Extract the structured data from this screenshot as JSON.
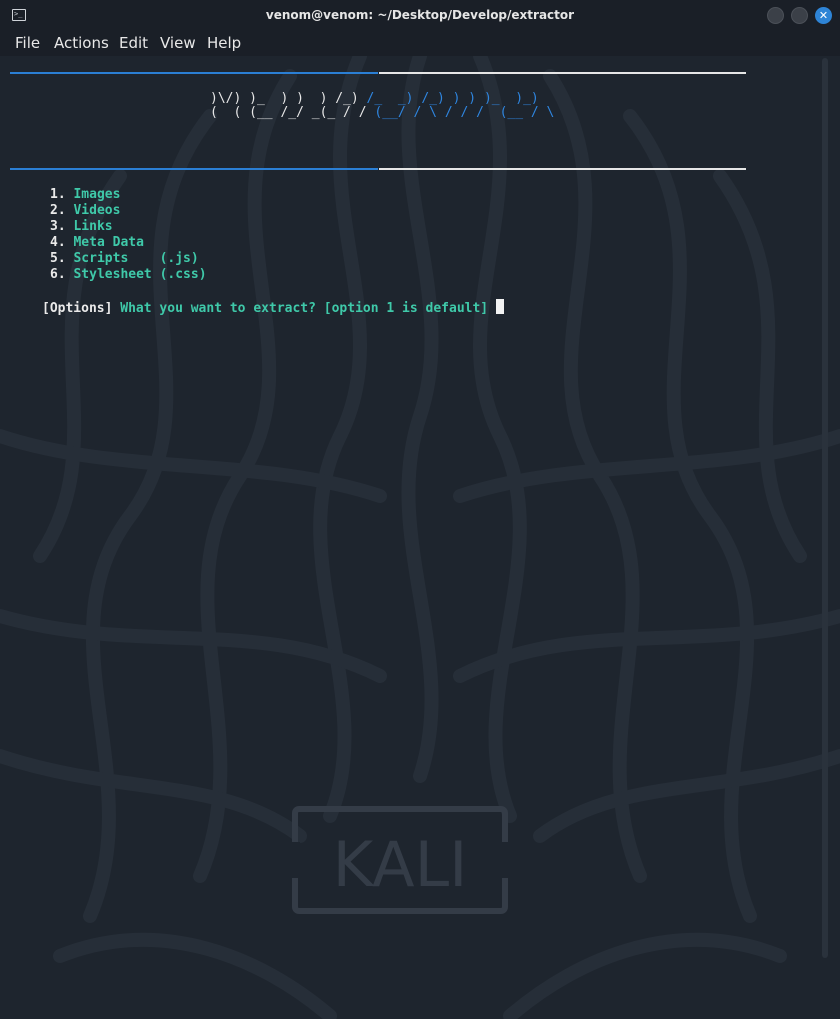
{
  "window": {
    "title": "venom@venom: ~/Desktop/Develop/extractor"
  },
  "menu": {
    "items": [
      {
        "label": "File"
      },
      {
        "label": "Actions"
      },
      {
        "label": "Edit"
      },
      {
        "label": "View"
      },
      {
        "label": "Help"
      }
    ]
  },
  "banner": {
    "line1_white": ")\\/) )_  ) )  ) /_)",
    "line1_blue": " /_  _) /_) ) ) )_  )_)",
    "line2_white": "(  ( (__ /_/ _(_ / /",
    "line2_blue": " (__/ / \\ / / /  (__ / \\"
  },
  "options": [
    {
      "num": "1.",
      "label": "Images"
    },
    {
      "num": "2.",
      "label": "Videos"
    },
    {
      "num": "3.",
      "label": "Links"
    },
    {
      "num": "4.",
      "label": "Meta Data"
    },
    {
      "num": "5.",
      "label": "Scripts    (.js)"
    },
    {
      "num": "6.",
      "label": "Stylesheet (.css)"
    }
  ],
  "prompt": {
    "tag": "[Options]",
    "question": " What you want to extract? [option 1 is default] "
  },
  "watermark": {
    "text": "KALI"
  },
  "colors": {
    "accent_blue": "#2b7fd4",
    "option_green": "#3fc9a9",
    "terminal_bg": "#1e252e"
  }
}
